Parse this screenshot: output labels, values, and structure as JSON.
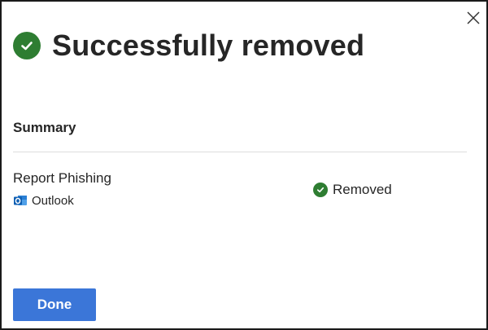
{
  "dialog": {
    "title": "Successfully removed",
    "close_icon": "close-icon",
    "title_icon": "check-circle-icon",
    "status_color": "#2e7d32"
  },
  "summary": {
    "heading": "Summary",
    "items": [
      {
        "name": "Report Phishing",
        "app": "Outlook",
        "app_icon": "outlook-icon",
        "status": "Removed",
        "status_icon": "check-circle-icon"
      }
    ]
  },
  "actions": {
    "done_label": "Done",
    "accent_color": "#3b76d8"
  }
}
